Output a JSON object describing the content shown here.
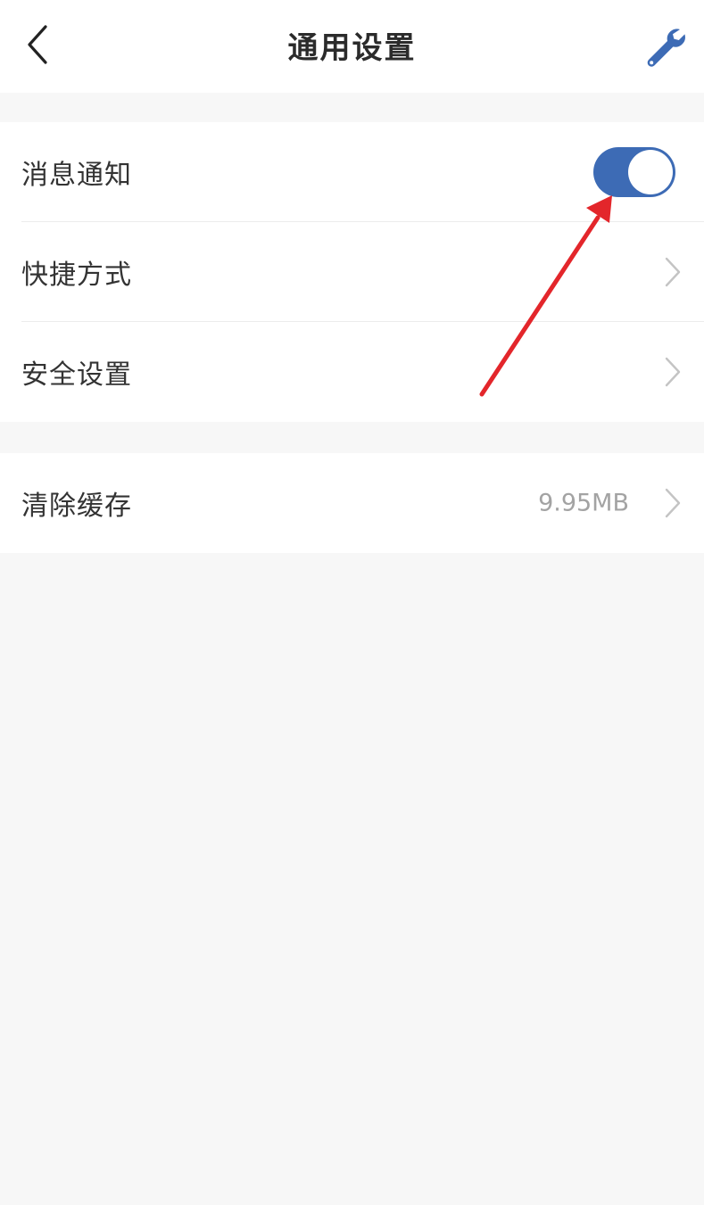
{
  "header": {
    "title": "通用设置",
    "back_icon": "chevron-left-icon",
    "tool_icon": "wrench-icon",
    "accent_color": "#3d6bb5"
  },
  "settings": {
    "group_1": [
      {
        "label": "消息通知",
        "control": "toggle",
        "toggle_on": true
      },
      {
        "label": "快捷方式",
        "control": "chevron"
      },
      {
        "label": "安全设置",
        "control": "chevron"
      }
    ],
    "group_2": [
      {
        "label": "清除缓存",
        "value": "9.95MB",
        "control": "chevron"
      }
    ]
  },
  "annotation": {
    "color": "#e3262b",
    "points_to": "消息通知 toggle"
  }
}
